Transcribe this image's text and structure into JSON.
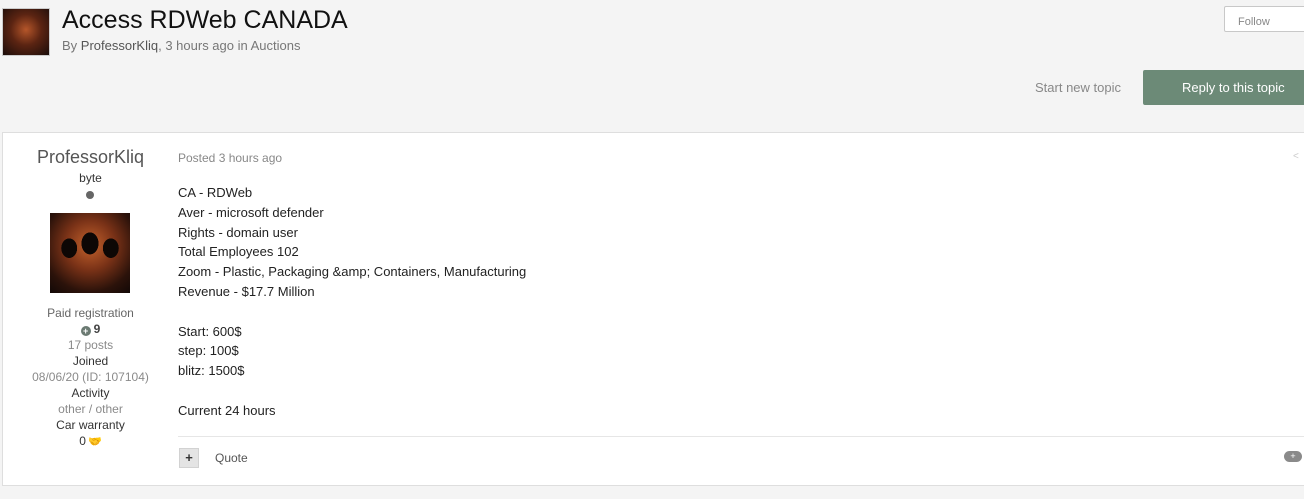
{
  "header": {
    "title": "Access RDWeb CANADA",
    "by_prefix": "By ",
    "author": "ProfessorKliq",
    "meta_suffix": ", 3 hours ago in Auctions",
    "follow_label": "Follow",
    "start_topic_label": "Start new topic",
    "reply_label": "Reply to this topic"
  },
  "author_panel": {
    "name": "ProfessorKliq",
    "rank": "byte",
    "group": "Paid registration",
    "reputation_icon": "plus-circle-icon",
    "reputation": "9",
    "posts": "17 posts",
    "joined_label": "Joined",
    "joined_value": "08/06/20 (ID: 107104)",
    "activity_label": "Activity",
    "activity_value": "other / other",
    "warranty_label": "Car warranty",
    "warranty_value": "0",
    "warranty_icon": "handshake-icon"
  },
  "post": {
    "posted": "Posted 3 hours ago",
    "lines": [
      "CA - RDWeb",
      "Aver - microsoft defender",
      "Rights - domain user",
      "Total Employees 102",
      "Zoom - Plastic, Packaging &amp; Containers, Manufacturing",
      "Revenue - $17.7 Million",
      "",
      "Start: 600$",
      "step: 100$",
      "blitz: 1500$",
      "",
      "Current 24 hours"
    ],
    "plus_label": "+",
    "quote_label": "Quote",
    "multiquote_icon": "multiquote-icon",
    "share_icon": "share-icon"
  },
  "colors": {
    "reply_button": "#6c8a77",
    "background": "#f4f4f4"
  }
}
